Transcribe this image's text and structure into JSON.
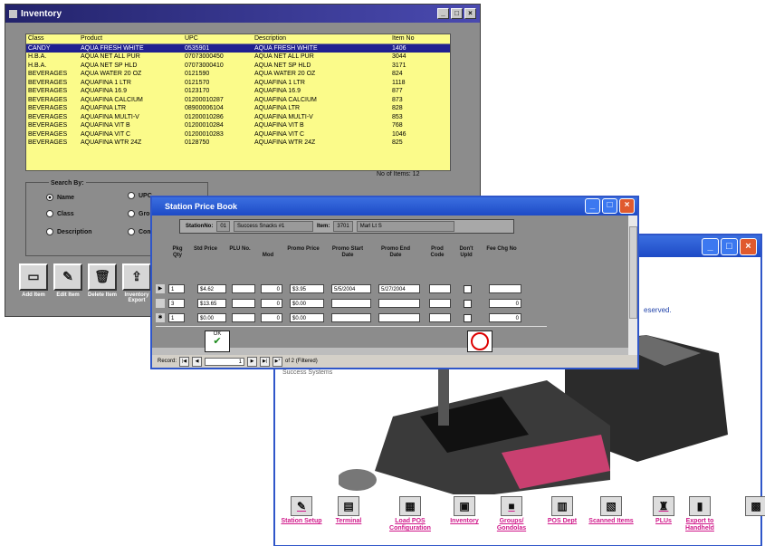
{
  "inventory": {
    "title": "Inventory",
    "columns": [
      "Class",
      "Product",
      "UPC",
      "Description",
      "Item No"
    ],
    "rows": [
      [
        "CANDY",
        "AQUA FRESH WHITE",
        "0535901",
        "AQUA FRESH WHITE",
        "1406"
      ],
      [
        "H.B.A.",
        "AQUA NET ALL PUR",
        "07073000450",
        "AQUA NET ALL PUR",
        "3044"
      ],
      [
        "H.B.A.",
        "AQUA NET SP HLD",
        "07073000410",
        "AQUA NET SP HLD",
        "3171"
      ],
      [
        "BEVERAGES",
        "AQUA WATER 20 OZ",
        "0121590",
        "AQUA WATER 20 OZ",
        "824"
      ],
      [
        "BEVERAGES",
        "AQUAFINA 1 LTR",
        "0121570",
        "AQUAFINA 1 LTR",
        "1118"
      ],
      [
        "BEVERAGES",
        "AQUAFINA 16.9",
        "0123170",
        "AQUAFINA 16.9",
        "877"
      ],
      [
        "BEVERAGES",
        "AQUAFINA CALCIUM",
        "01200010287",
        "AQUAFINA CALCIUM",
        "873"
      ],
      [
        "BEVERAGES",
        "AQUAFINA LTR",
        "08900006104",
        "AQUAFINA LTR",
        "828"
      ],
      [
        "BEVERAGES",
        "AQUAFINA MULTI-V",
        "01200010286",
        "AQUAFINA MULTI-V",
        "853"
      ],
      [
        "BEVERAGES",
        "AQUAFINA VIT B",
        "01200010284",
        "AQUAFINA VIT B",
        "768"
      ],
      [
        "BEVERAGES",
        "AQUAFINA VIT C",
        "01200010283",
        "AQUAFINA VIT C",
        "1046"
      ],
      [
        "BEVERAGES",
        "AQUAFINA WTR 24Z",
        "0128750",
        "AQUAFINA WTR 24Z",
        "825"
      ]
    ],
    "count_label": "No of Items: 12",
    "search_by": "Search By:",
    "options": {
      "name": "Name",
      "upc": "UPC",
      "class": "Class",
      "group": "Grou",
      "description": "Description",
      "comm": "Comm"
    },
    "toolbar": {
      "add": "Add Item",
      "edit": "Edit Item",
      "delete": "Delete Item",
      "export": "Inventory Export"
    }
  },
  "pricebook": {
    "title": "Station Price Book",
    "station_label": "StationNo:",
    "station_no": "01",
    "station_name": "Success Snacks #1",
    "item_label": "Item:",
    "item_no": "3701",
    "item_desc": "Marl Lt S",
    "headers": {
      "pkg": "Pkg Qty",
      "std": "Std Price",
      "plu": "PLU No.",
      "mod": "Mod",
      "promo": "Promo Price",
      "pstart": "Promo Start Date",
      "pend": "Promo End Date",
      "prod": "Prod Code",
      "dont": "Don't Upld",
      "fee": "Fee Chg No"
    },
    "rows": [
      {
        "ind": "▶",
        "pkg": "1",
        "std": "$4.62",
        "plu": "",
        "mod": "0",
        "promo": "$3.95",
        "pstart": "5/5/2004",
        "pend": "5/27/2004",
        "prod": "",
        "fee": ""
      },
      {
        "ind": "",
        "pkg": "3",
        "std": "$13.65",
        "plu": "",
        "mod": "0",
        "promo": "$0.00",
        "pstart": "",
        "pend": "",
        "prod": "",
        "fee": "0"
      },
      {
        "ind": "✱",
        "pkg": "1",
        "std": "$0.00",
        "plu": "",
        "mod": "0",
        "promo": "$0.00",
        "pstart": "",
        "pend": "",
        "prod": "",
        "fee": "0"
      }
    ],
    "ok_label": "OK",
    "record_label": "Record:",
    "record_no": "1",
    "record_of": "of 2 (Filtered)"
  },
  "pos": {
    "reserved": "eserved.",
    "systems": "Success Systems",
    "nav": [
      {
        "id": "station",
        "label": "Station Setup",
        "icon": "✎"
      },
      {
        "id": "terminal",
        "label": "Terminal",
        "icon": "▤"
      },
      {
        "id": "loadpos",
        "label": "Load POS Configuration",
        "icon": "▦"
      },
      {
        "id": "inventory",
        "label": "Inventory",
        "icon": "▣"
      },
      {
        "id": "groups",
        "label": "Groups/ Gondolas",
        "icon": "■"
      },
      {
        "id": "posdept",
        "label": "POS Dept",
        "icon": "▥"
      },
      {
        "id": "scanned",
        "label": "Scanned Items",
        "icon": "▧"
      },
      {
        "id": "plus",
        "label": "PLUs",
        "icon": "♜"
      },
      {
        "id": "export",
        "label": "Export to Handheld",
        "icon": "▮"
      },
      {
        "id": "exit",
        "label": "",
        "icon": "▩"
      }
    ]
  },
  "colors": {
    "grid_bg": "#fbfb8a",
    "selected_row": "#202090",
    "xp_title": "#1d4ac6",
    "nav_text": "#d0188a"
  }
}
